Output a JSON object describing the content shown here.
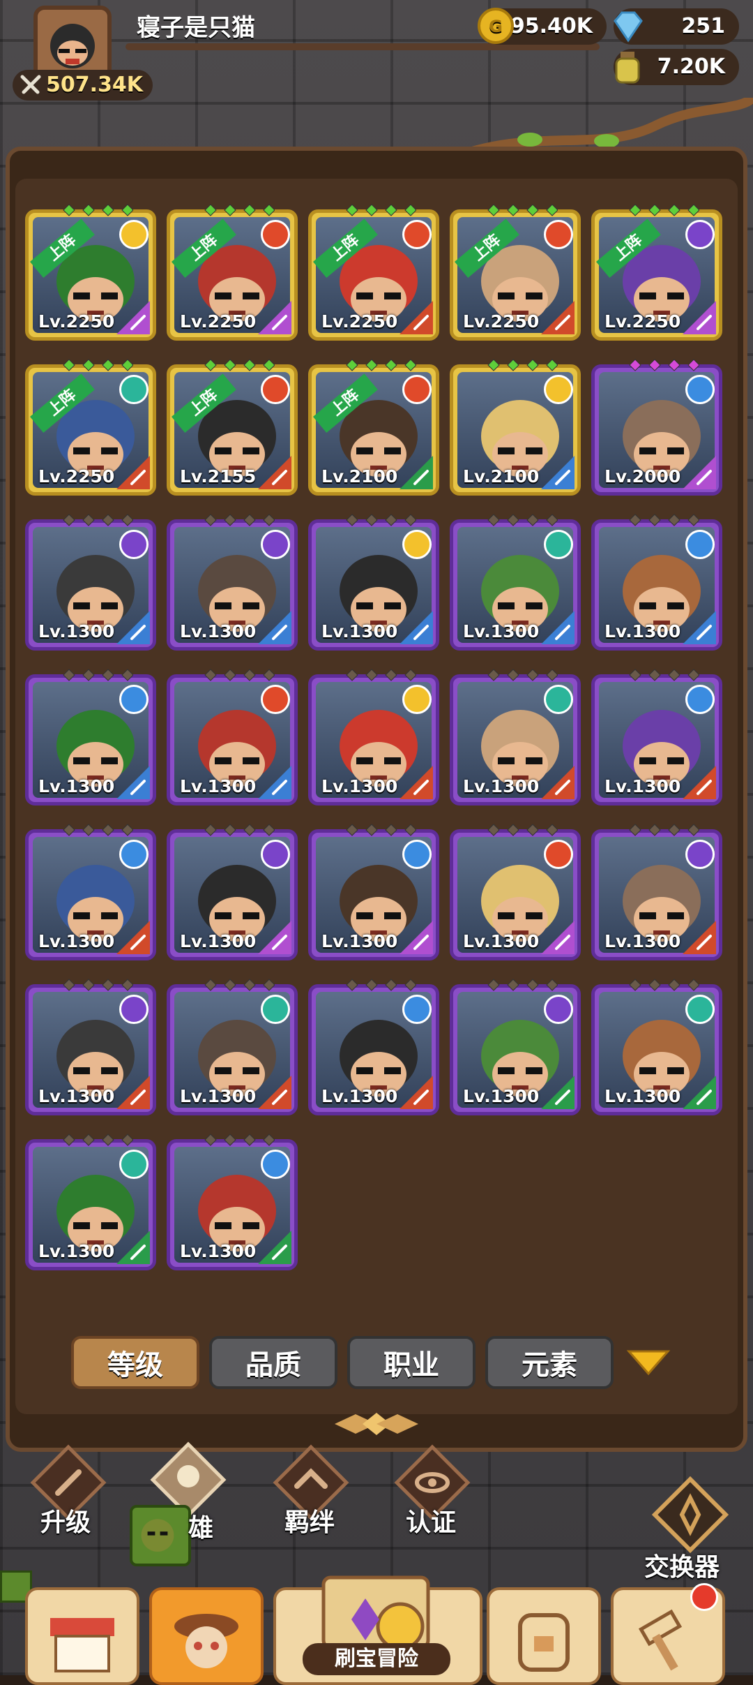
{
  "player": {
    "name": "寝子是只猫",
    "power": "507.34K",
    "gold": "195.40K",
    "gems": "251",
    "potion": "7.20K"
  },
  "heroes": [
    {
      "level": "Lv.2250",
      "rarity": "gold",
      "deployed": true,
      "element": "light",
      "cls": "staff"
    },
    {
      "level": "Lv.2250",
      "rarity": "gold",
      "deployed": true,
      "element": "fire",
      "cls": "staff"
    },
    {
      "level": "Lv.2250",
      "rarity": "gold",
      "deployed": true,
      "element": "fire",
      "cls": "sword"
    },
    {
      "level": "Lv.2250",
      "rarity": "gold",
      "deployed": true,
      "element": "fire",
      "cls": "sword"
    },
    {
      "level": "Lv.2250",
      "rarity": "gold",
      "deployed": true,
      "element": "dark",
      "cls": "staff"
    },
    {
      "level": "Lv.2250",
      "rarity": "gold",
      "deployed": true,
      "element": "wind",
      "cls": "sword"
    },
    {
      "level": "Lv.2155",
      "rarity": "gold",
      "deployed": true,
      "element": "fire",
      "cls": "bow"
    },
    {
      "level": "Lv.2100",
      "rarity": "gold",
      "deployed": true,
      "element": "fire",
      "cls": "shield"
    },
    {
      "level": "Lv.2100",
      "rarity": "gold",
      "deployed": false,
      "element": "light",
      "cls": "cross"
    },
    {
      "level": "Lv.2000",
      "rarity": "purple",
      "deployed": false,
      "element": "water",
      "cls": "staff"
    },
    {
      "level": "Lv.1300",
      "rarity": "purple",
      "deployed": false,
      "element": "dark",
      "cls": "cross"
    },
    {
      "level": "Lv.1300",
      "rarity": "purple",
      "deployed": false,
      "element": "dark",
      "cls": "cross"
    },
    {
      "level": "Lv.1300",
      "rarity": "purple",
      "deployed": false,
      "element": "light",
      "cls": "cross"
    },
    {
      "level": "Lv.1300",
      "rarity": "purple",
      "deployed": false,
      "element": "wind",
      "cls": "cross"
    },
    {
      "level": "Lv.1300",
      "rarity": "purple",
      "deployed": false,
      "element": "water",
      "cls": "cross"
    },
    {
      "level": "Lv.1300",
      "rarity": "purple",
      "deployed": false,
      "element": "water",
      "cls": "cross"
    },
    {
      "level": "Lv.1300",
      "rarity": "purple",
      "deployed": false,
      "element": "fire",
      "cls": "cross"
    },
    {
      "level": "Lv.1300",
      "rarity": "purple",
      "deployed": false,
      "element": "light",
      "cls": "bow"
    },
    {
      "level": "Lv.1300",
      "rarity": "purple",
      "deployed": false,
      "element": "wind",
      "cls": "bow"
    },
    {
      "level": "Lv.1300",
      "rarity": "purple",
      "deployed": false,
      "element": "water",
      "cls": "bow"
    },
    {
      "level": "Lv.1300",
      "rarity": "purple",
      "deployed": false,
      "element": "water",
      "cls": "bow"
    },
    {
      "level": "Lv.1300",
      "rarity": "purple",
      "deployed": false,
      "element": "dark",
      "cls": "staff"
    },
    {
      "level": "Lv.1300",
      "rarity": "purple",
      "deployed": false,
      "element": "water",
      "cls": "staff"
    },
    {
      "level": "Lv.1300",
      "rarity": "purple",
      "deployed": false,
      "element": "fire",
      "cls": "staff"
    },
    {
      "level": "Lv.1300",
      "rarity": "purple",
      "deployed": false,
      "element": "dark",
      "cls": "sword"
    },
    {
      "level": "Lv.1300",
      "rarity": "purple",
      "deployed": false,
      "element": "dark",
      "cls": "sword"
    },
    {
      "level": "Lv.1300",
      "rarity": "purple",
      "deployed": false,
      "element": "wind",
      "cls": "sword"
    },
    {
      "level": "Lv.1300",
      "rarity": "purple",
      "deployed": false,
      "element": "water",
      "cls": "sword"
    },
    {
      "level": "Lv.1300",
      "rarity": "purple",
      "deployed": false,
      "element": "dark",
      "cls": "shield"
    },
    {
      "level": "Lv.1300",
      "rarity": "purple",
      "deployed": false,
      "element": "wind",
      "cls": "shield"
    },
    {
      "level": "Lv.1300",
      "rarity": "purple",
      "deployed": false,
      "element": "wind",
      "cls": "shield"
    },
    {
      "level": "Lv.1300",
      "rarity": "purple",
      "deployed": false,
      "element": "water",
      "cls": "shield"
    }
  ],
  "deployed_label": "上阵",
  "filters": {
    "level": "等级",
    "quality": "品质",
    "job": "职业",
    "element": "元素"
  },
  "nav": {
    "upgrade": "升级",
    "hero": "雄",
    "bond": "羁绊",
    "certify": "认证",
    "exchanger": "交换器",
    "adventure": "刷宝冒险"
  },
  "colors": {
    "fire": "#e04a2a",
    "water": "#3b8ce0",
    "wind": "#2bb59a",
    "light": "#f3c12c",
    "dark": "#7a44c9",
    "panel": "#4a3322"
  }
}
